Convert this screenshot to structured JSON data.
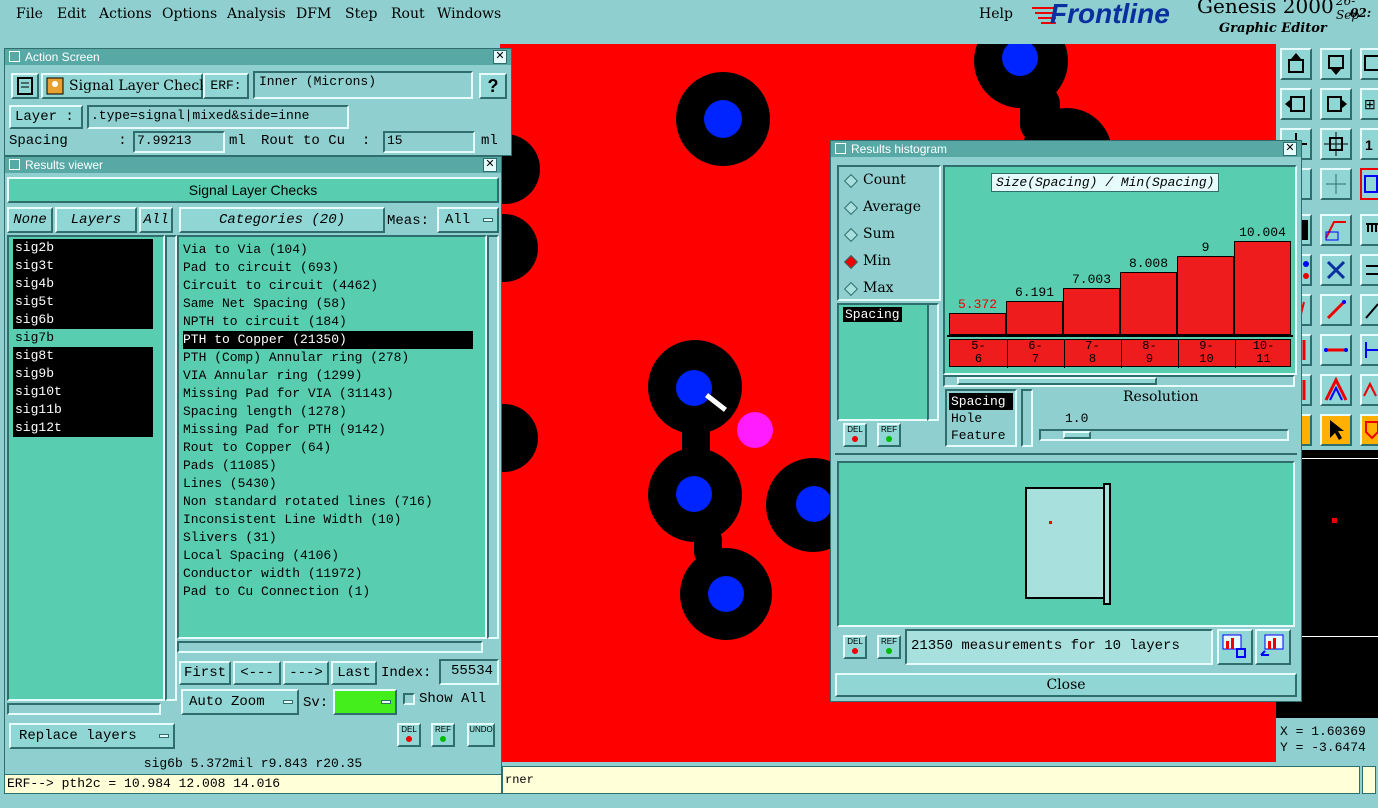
{
  "menu": {
    "items": [
      "File",
      "Edit",
      "Actions",
      "Options",
      "Analysis",
      "DFM",
      "Step",
      "Rout",
      "Windows"
    ],
    "help": "Help"
  },
  "brand": {
    "logo": "Frontline",
    "product": "Genesis 2000",
    "subtitle": "Graphic Editor",
    "clock_top": "26-Sep",
    "clock_bottom": "02:"
  },
  "action_screen": {
    "title": "Action Screen",
    "name": "Signal Layer Checks",
    "erf_label": "ERF:",
    "erf_value": "Inner (Microns)",
    "help": "?",
    "layer_label": "Layer :",
    "layer_value": ".type=signal|mixed&side=inne",
    "spacing_label": "Spacing      :",
    "spacing_value": "7.99213",
    "spacing_unit": "ml",
    "rout_label": "Rout to Cu  :",
    "rout_value": "15",
    "rout_unit": "ml"
  },
  "results_viewer": {
    "title": "Results viewer",
    "header": "Signal Layer Checks",
    "none_btn": "None",
    "layers_btn": "Layers",
    "all_btn": "All",
    "layers": [
      {
        "name": "sig2b",
        "selected": true
      },
      {
        "name": "sig3t",
        "selected": true
      },
      {
        "name": "sig4b",
        "selected": true
      },
      {
        "name": "sig5t",
        "selected": true
      },
      {
        "name": "sig6b",
        "selected": true
      },
      {
        "name": "sig7b",
        "selected": false
      },
      {
        "name": "sig8t",
        "selected": true
      },
      {
        "name": "sig9b",
        "selected": true
      },
      {
        "name": "sig10t",
        "selected": true
      },
      {
        "name": "sig11b",
        "selected": true
      },
      {
        "name": "sig12t",
        "selected": true
      }
    ],
    "categories_btn": "Categories (20)",
    "meas_label": "Meas:",
    "meas_value": "All",
    "categories": [
      {
        "label": "Via to Via (104)",
        "selected": false
      },
      {
        "label": "Pad to circuit (693)",
        "selected": false
      },
      {
        "label": "Circuit to circuit (4462)",
        "selected": false
      },
      {
        "label": "Same Net Spacing (58)",
        "selected": false
      },
      {
        "label": "NPTH to circuit (184)",
        "selected": false
      },
      {
        "label": "PTH to Copper (21350)",
        "selected": true
      },
      {
        "label": "PTH (Comp) Annular ring (278)",
        "selected": false
      },
      {
        "label": "VIA Annular ring (1299)",
        "selected": false
      },
      {
        "label": "Missing Pad for VIA (31143)",
        "selected": false
      },
      {
        "label": "Spacing length (1278)",
        "selected": false
      },
      {
        "label": "Missing Pad for PTH (9142)",
        "selected": false
      },
      {
        "label": "Rout to Copper (64)",
        "selected": false
      },
      {
        "label": "Pads (11085)",
        "selected": false
      },
      {
        "label": "Lines (5430)",
        "selected": false
      },
      {
        "label": "Non standard rotated lines (716)",
        "selected": false
      },
      {
        "label": "Inconsistent Line Width (10)",
        "selected": false
      },
      {
        "label": "Slivers (31)",
        "selected": false
      },
      {
        "label": "Local Spacing (4106)",
        "selected": false
      },
      {
        "label": "Conductor width (11972)",
        "selected": false
      },
      {
        "label": "Pad to Cu Connection (1)",
        "selected": false
      }
    ],
    "first_btn": "First",
    "prev_btn": "<---",
    "next_btn": "--->",
    "last_btn": "Last",
    "index_label": "Index:",
    "index_value": "55534",
    "autozoom": "Auto Zoom",
    "sv_label": "Sv:",
    "show_all": "Show All",
    "replace_layers": "Replace layers",
    "del": "DEL",
    "ref": "REF",
    "undo": "UNDO",
    "status": "sig6b 5.372mil  r9.843  r20.35",
    "erf_status": "ERF--> pth2c = 10.984 12.008 14.016"
  },
  "histogram": {
    "title": "Results histogram",
    "modes": [
      "Count",
      "Average",
      "Sum",
      "Min",
      "Max"
    ],
    "selected_mode": "Min",
    "list_item": "Spacing",
    "chart_title": "Size(Spacing) / Min(Spacing)",
    "resolution_label": "Resolution",
    "resolution_value": "1.0",
    "attr_items": [
      "Spacing",
      "Hole",
      "Feature"
    ],
    "measurements": "21350 measurements for 10 layers",
    "close": "Close",
    "del": "DEL",
    "ref": "REF"
  },
  "chart_data": {
    "type": "bar",
    "title": "Size(Spacing) / Min(Spacing)",
    "categories": [
      "5-6",
      "6-7",
      "7-8",
      "8-9",
      "9-10",
      "10-11"
    ],
    "category_labels": [
      [
        "5-",
        "6"
      ],
      [
        "6-",
        "7"
      ],
      [
        "7-",
        "8"
      ],
      [
        "8-",
        "9"
      ],
      [
        "9-",
        "10"
      ],
      [
        "10-",
        "11"
      ]
    ],
    "values": [
      5.372,
      6.191,
      7.003,
      8.008,
      9,
      10.004
    ],
    "value_labels": [
      "5.372",
      "6.191",
      "7.003",
      "8.008",
      "9",
      "10.004"
    ],
    "ylim": [
      0,
      11
    ],
    "bar_color": "#ee1c1c",
    "highlight_color": "#ee1c1c"
  },
  "bottom_status": {
    "text": "rner"
  },
  "coords": {
    "x": "X = 1.60369",
    "y": "Y = -3.6474"
  },
  "colors": {
    "background": "#8fcfcf",
    "canvas_red": "#ff0000",
    "via_blue": "#0024ff",
    "highlight_magenta": "#ff1cff",
    "bar_red": "#ee1c1c"
  }
}
